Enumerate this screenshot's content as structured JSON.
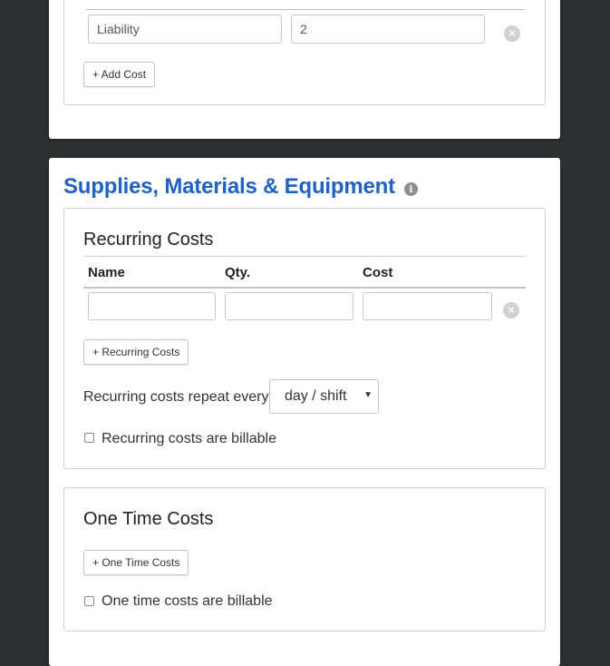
{
  "costs_section": {
    "row": {
      "name_value": "Liability",
      "qty_value": "2"
    },
    "add_button": "+ Add Cost"
  },
  "supplies": {
    "title": "Supplies, Materials & Equipment",
    "info_icon": "i",
    "recurring": {
      "title": "Recurring Costs",
      "columns": [
        "Name",
        "Qty.",
        "Cost"
      ],
      "row": {
        "name_value": "",
        "qty_value": "",
        "cost_value": ""
      },
      "add_button": "+ Recurring Costs",
      "repeat_label": "Recurring costs repeat every",
      "repeat_select": {
        "selected": "day / shift"
      },
      "billable_label": "Recurring costs are billable",
      "billable_checked": false
    },
    "one_time": {
      "title": "One Time Costs",
      "add_button": "+ One Time Costs",
      "billable_label": "One time costs are billable",
      "billable_checked": false
    }
  },
  "icons": {
    "remove": "close-circle-icon",
    "info": "info-circle-icon",
    "dropdown": "caret-down-icon"
  },
  "colors": {
    "background": "#2e2f31",
    "title_accent": "#1f63c2"
  }
}
